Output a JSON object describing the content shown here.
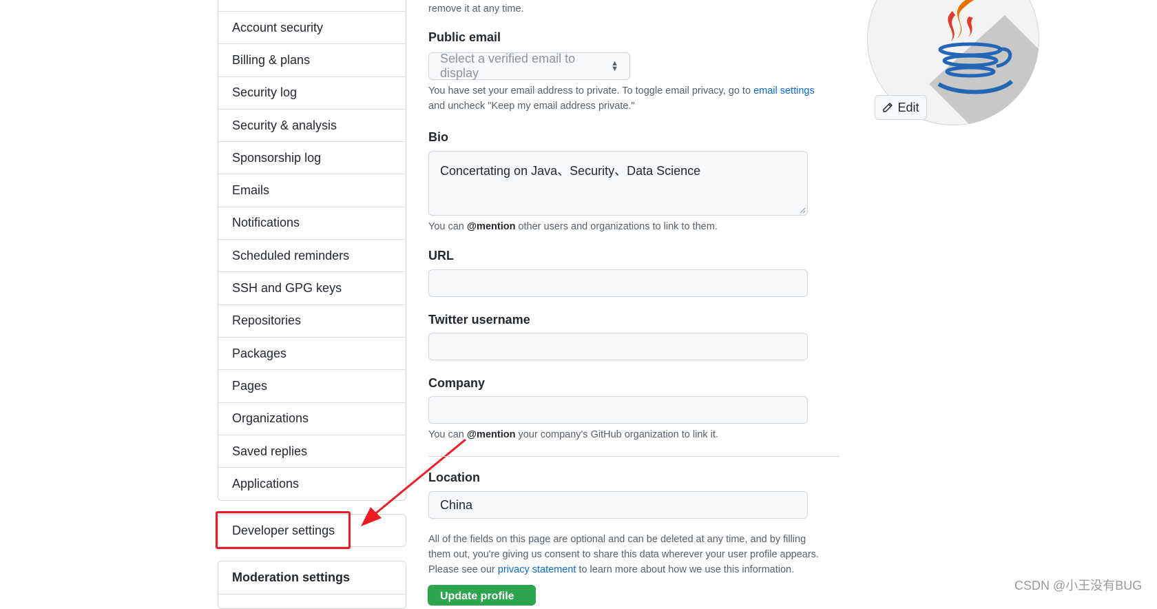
{
  "sidebar": {
    "items": [
      "Account security",
      "Billing & plans",
      "Security log",
      "Security & analysis",
      "Sponsorship log",
      "Emails",
      "Notifications",
      "Scheduled reminders",
      "SSH and GPG keys",
      "Repositories",
      "Packages",
      "Pages",
      "Organizations",
      "Saved replies",
      "Applications"
    ],
    "developer_settings": "Developer settings",
    "moderation_settings": "Moderation settings"
  },
  "form": {
    "top_note": "remove it at any time.",
    "public_email": {
      "label": "Public email",
      "placeholder": "Select a verified email to display",
      "note_prefix": "You have set your email address to private. To toggle email privacy, go to ",
      "note_link": "email settings",
      "note_suffix": "and uncheck \"Keep my email address private.\""
    },
    "bio": {
      "label": "Bio",
      "value": "Concertating on Java、Security、Data Science",
      "note_prefix": "You can ",
      "note_strong": "@mention",
      "note_suffix": " other users and organizations to link to them."
    },
    "url": {
      "label": "URL",
      "value": ""
    },
    "twitter": {
      "label": "Twitter username",
      "value": ""
    },
    "company": {
      "label": "Company",
      "value": "",
      "note_prefix": "You can ",
      "note_strong": "@mention",
      "note_suffix": " your company's GitHub organization to link it."
    },
    "location": {
      "label": "Location",
      "value": "China"
    },
    "footer": {
      "line1": "All of the fields on this page are optional and can be deleted at any time, and by filling",
      "line2": "them out, you're giving us consent to share this data wherever your user profile appears.",
      "line3_prefix": "Please see our ",
      "line3_link": "privacy statement",
      "line3_suffix": " to learn more about how we use this information."
    },
    "update_button": "Update profile"
  },
  "avatar": {
    "edit_label": "Edit"
  },
  "watermark": "CSDN @小王没有BUG",
  "colors": {
    "accent_link": "#0969da",
    "annotation_red": "#ee1c25",
    "primary_green": "#2da44e"
  }
}
